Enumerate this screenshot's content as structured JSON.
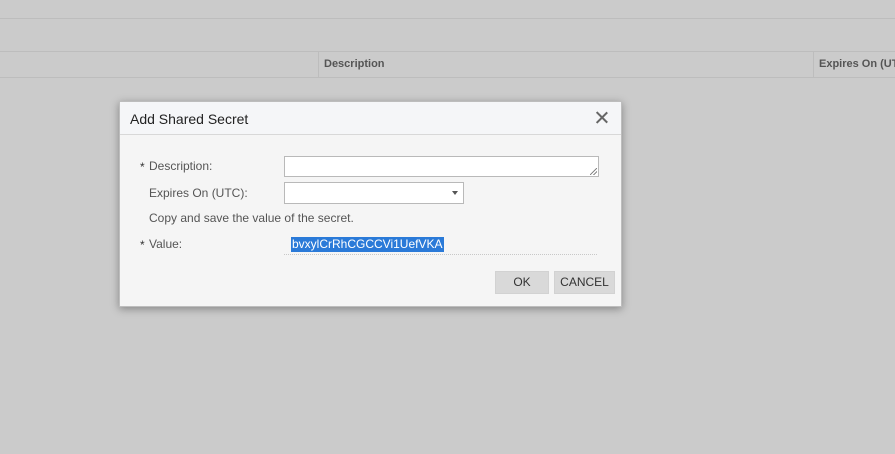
{
  "grid": {
    "columns": [
      {
        "label": "Description"
      },
      {
        "label": "Expires On (UTC)"
      }
    ]
  },
  "dialog": {
    "title": "Add Shared Secret",
    "required_marker": "*",
    "fields": {
      "description_label": "Description:",
      "description_value": "",
      "expires_label": "Expires On (UTC):",
      "expires_value": "",
      "hint": "Copy and save the value of the secret.",
      "value_label": "Value:",
      "value_text": "bvxylCrRhCGCCVi1UefVKA"
    },
    "buttons": {
      "ok": "OK",
      "cancel": "CANCEL"
    }
  }
}
